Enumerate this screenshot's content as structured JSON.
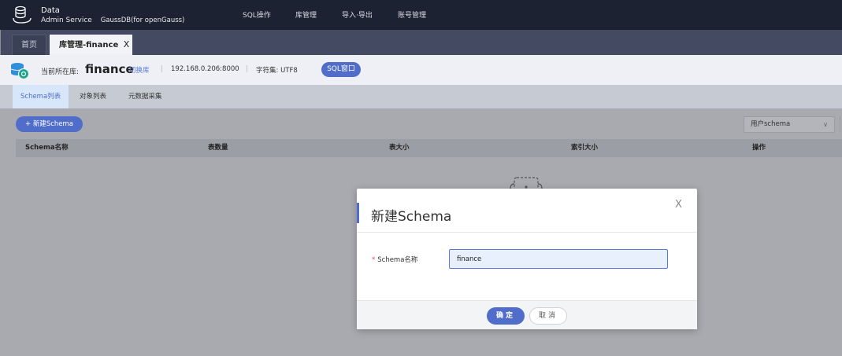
{
  "app": {
    "name": "Data",
    "subtitle": "Admin Service",
    "product": "GaussDB(for openGauss)"
  },
  "nav": {
    "items": [
      {
        "label": "SQL操作"
      },
      {
        "label": "库管理"
      },
      {
        "label": "导入·导出"
      },
      {
        "label": "账号管理"
      }
    ]
  },
  "tabs": {
    "home": "首页",
    "active": "库管理-finance",
    "close": "X"
  },
  "info": {
    "current_db_label": "当前所在库:",
    "db_name": "finance",
    "switch_label": "切换库",
    "separator": "|",
    "host": "192.168.0.206:8000",
    "charset": "字符集: UTF8",
    "sql_window": "SQL窗口"
  },
  "subtabs": [
    {
      "label": "Schema列表"
    },
    {
      "label": "对象列表"
    },
    {
      "label": "元数据采集"
    }
  ],
  "toolbar": {
    "new_schema": "+ 新建Schema",
    "filter_value": "用户schema"
  },
  "table": {
    "columns": [
      "Schema名称",
      "表数量",
      "表大小",
      "索引大小",
      "操作"
    ]
  },
  "modal": {
    "title": "新建Schema",
    "close": "X",
    "field_label": "Schema名称",
    "required_mark": "*",
    "field_value": "finance",
    "ok": "确定",
    "cancel": "取消"
  },
  "colors": {
    "topnav": "#1d2233",
    "tabbar": "#434a61",
    "accent": "#4f6dc9",
    "overlay": "#a9aab0"
  }
}
